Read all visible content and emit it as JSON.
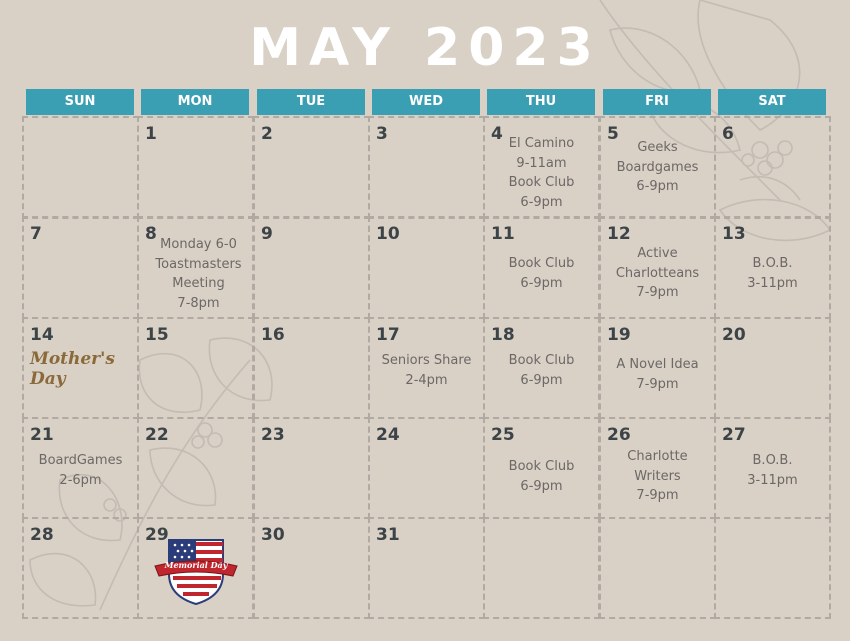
{
  "title": "MAY 2023",
  "colors": {
    "background": "#d9d0c6",
    "header": "#3b9fb3",
    "title": "#ffffff",
    "grid": "#b0aaa3",
    "event_text": "#6b6866",
    "day_number": "#3d4448"
  },
  "weekdays": [
    "SUN",
    "MON",
    "TUE",
    "WED",
    "THU",
    "FRI",
    "SAT"
  ],
  "weeks": [
    [
      {
        "day": ""
      },
      {
        "day": "1"
      },
      {
        "day": "2"
      },
      {
        "day": "3"
      },
      {
        "day": "4",
        "events": [
          "El Camino",
          "9-11am",
          "Book Club",
          "6-9pm"
        ]
      },
      {
        "day": "5",
        "events": [
          "Geeks",
          "Boardgames",
          "6-9pm"
        ]
      },
      {
        "day": "6"
      }
    ],
    [
      {
        "day": "7"
      },
      {
        "day": "8",
        "events": [
          "Monday 6-0",
          "Toastmasters",
          "Meeting",
          "7-8pm"
        ]
      },
      {
        "day": "9"
      },
      {
        "day": "10"
      },
      {
        "day": "11",
        "events": [
          "Book Club",
          "6-9pm"
        ]
      },
      {
        "day": "12",
        "events": [
          "Active",
          "Charlotteans",
          "7-9pm"
        ]
      },
      {
        "day": "13",
        "events": [
          "B.O.B.",
          "3-11pm"
        ]
      }
    ],
    [
      {
        "day": "14",
        "badge": "Mother's Day"
      },
      {
        "day": "15"
      },
      {
        "day": "16"
      },
      {
        "day": "17",
        "events": [
          "Seniors Share",
          "2-4pm"
        ]
      },
      {
        "day": "18",
        "events": [
          "Book Club",
          "6-9pm"
        ]
      },
      {
        "day": "19",
        "events": [
          "A Novel Idea",
          "7-9pm"
        ]
      },
      {
        "day": "20"
      }
    ],
    [
      {
        "day": "21",
        "events": [
          "BoardGames",
          "2-6pm"
        ]
      },
      {
        "day": "22"
      },
      {
        "day": "23"
      },
      {
        "day": "24"
      },
      {
        "day": "25",
        "events": [
          "Book Club",
          "6-9pm"
        ]
      },
      {
        "day": "26",
        "events": [
          "Charlotte",
          "Writers",
          "7-9pm"
        ]
      },
      {
        "day": "27",
        "events": [
          "B.O.B.",
          "3-11pm"
        ]
      }
    ],
    [
      {
        "day": "28"
      },
      {
        "day": "29",
        "badge": "Memorial Day"
      },
      {
        "day": "30"
      },
      {
        "day": "31"
      },
      {
        "day": ""
      },
      {
        "day": ""
      },
      {
        "day": ""
      }
    ]
  ]
}
